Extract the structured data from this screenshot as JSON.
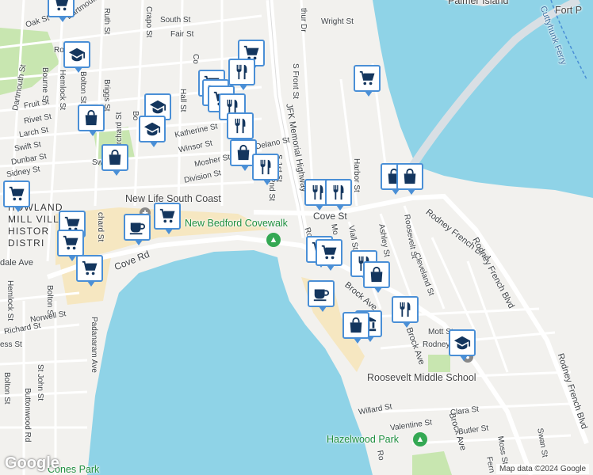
{
  "map": {
    "streets": {
      "south_st": "South St",
      "fair_st": "Fair St",
      "wright_st": "Wright St",
      "oak_st": "Oak St",
      "dartmouth_st_top": "Dartmouth St",
      "dartmouth_st": "Dartmouth St",
      "ruth_st": "Ruth St",
      "crapo_st": "Crapo St",
      "orchard_st": "Orchard St",
      "bolton_st": "Bolton St",
      "bourne_st": "Bourne St",
      "hemlock_st": "Hemlock St",
      "briggs_st": "Briggs St",
      "fruit_st": "Fruit St",
      "rivet_st": "Rivet St",
      "larch_st": "Larch St",
      "swift_st": "Swift St",
      "dunbar_st": "Dunbar St",
      "sidney_st": "Sidney St",
      "hall_st": "Hall St",
      "katherine_st": "Katherine St",
      "winsor_st": "Winsor St",
      "mosher_st": "Mosher St",
      "division_st": "Division St",
      "delano_st": "Delano St",
      "s_front_st": "S Front St",
      "jfk_hwy": "JFK Memorial Highway",
      "s_1st_st": "S 1st St",
      "s_2nd_st": "2nd St",
      "cove_st": "Cove St",
      "cove_rd": "Cove Rd",
      "rodney_french_blvd": "Rodney French Blvd",
      "rodney_french_blvd_lower": "Rodney French Blvd",
      "rodney_french_blvd_s": "Rodney French Blvd",
      "harbor_st": "Harbor St",
      "viall_st": "Viall St",
      "ashley_st": "Ashley St",
      "roosevelt_st": "Roosevelt St",
      "cleveland_st": "Cleveland St",
      "brock_ave": "Brock Ave",
      "brock_ave_s": "Brock Ave",
      "mott_st": "Mott St",
      "rodney_st": "Rodney",
      "willard_st": "Willard St",
      "valentine_st": "Valentine St",
      "clara_st": "Clara St",
      "butler_st": "Butler St",
      "moss_st": "Moss St",
      "swan_st": "Swan St",
      "fern_st": "Fern St",
      "ferry": "Cuttyhunk Ferry",
      "hemlock_st_s": "Hemlock St",
      "bolton_st_s": "Bolton St",
      "norwell_st": "Norwell St",
      "richard_st": "Richard St",
      "padanaram_ave": "Padanaram Ave",
      "st_john_st": "St John St",
      "buttonwood_rd": "Buttonwood Rd",
      "bolton_st_low": "Bolton St",
      "dale_ave": "dale Ave",
      "ess_st": "ess St",
      "rd_st": "Rd",
      "st_top": "St",
      "arthur_dr": "thur Dr",
      "ro_st": "Ro",
      "co_st": "Co",
      "bo_st": "Bo",
      "mo_st": "Mo",
      "chard_st": "chard St",
      "mor_st": "Mor",
      "ar_st": "Ar",
      "sw_st": "Sw",
      "sher_st": "shert St"
    },
    "places": {
      "palmer_island": "Palmer Island",
      "fort_phoenix": "Fort P",
      "new_life": "New Life South Coast",
      "historic_district": [
        "HOWLAND",
        "MILL VILL",
        "HISTOR",
        "DISTRI"
      ],
      "covewalk": "New Bedford Covewalk",
      "roosevelt_ms": "Roosevelt Middle School",
      "hazelwood_park": "Hazelwood Park",
      "cones_park": "Cones Park"
    },
    "attribution": "Map data ©2024 Google",
    "logo": "Google",
    "colors": {
      "water": "#8fd3e7",
      "land": "#f2f1ee",
      "park": "#c8e6b0",
      "sand": "#f6e7c1",
      "pin_border": "#4a8fd6",
      "icon_navy": "#14365e",
      "green_poi": "#34a853"
    },
    "marker_types": [
      "shopping-cart",
      "restaurant",
      "shopping-bag",
      "school",
      "cafe",
      "bank"
    ]
  }
}
